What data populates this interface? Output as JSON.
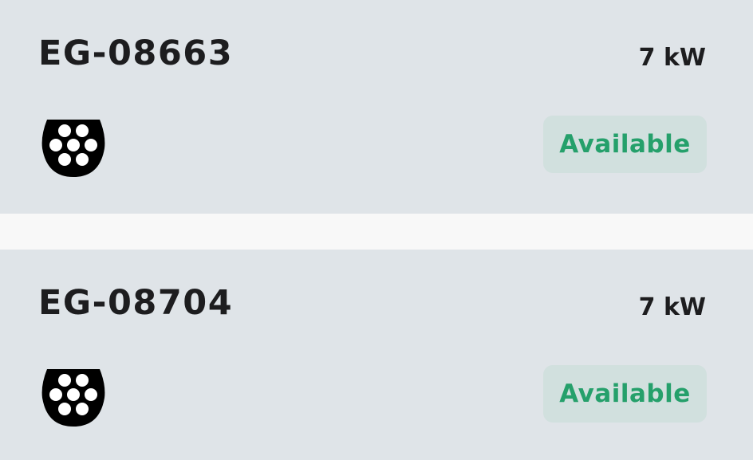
{
  "chargers": [
    {
      "id": "EG-08663",
      "power": "7 kW",
      "connector_icon": "type2-connector-icon",
      "status": "Available"
    },
    {
      "id": "EG-08704",
      "power": "7 kW",
      "connector_icon": "type2-connector-icon",
      "status": "Available"
    }
  ],
  "colors": {
    "card_background": "#dfe4e8",
    "page_background": "#f8f8f8",
    "status_badge_background": "#d1e0de",
    "status_text": "#25a06b",
    "primary_text": "#1d1d1f"
  }
}
